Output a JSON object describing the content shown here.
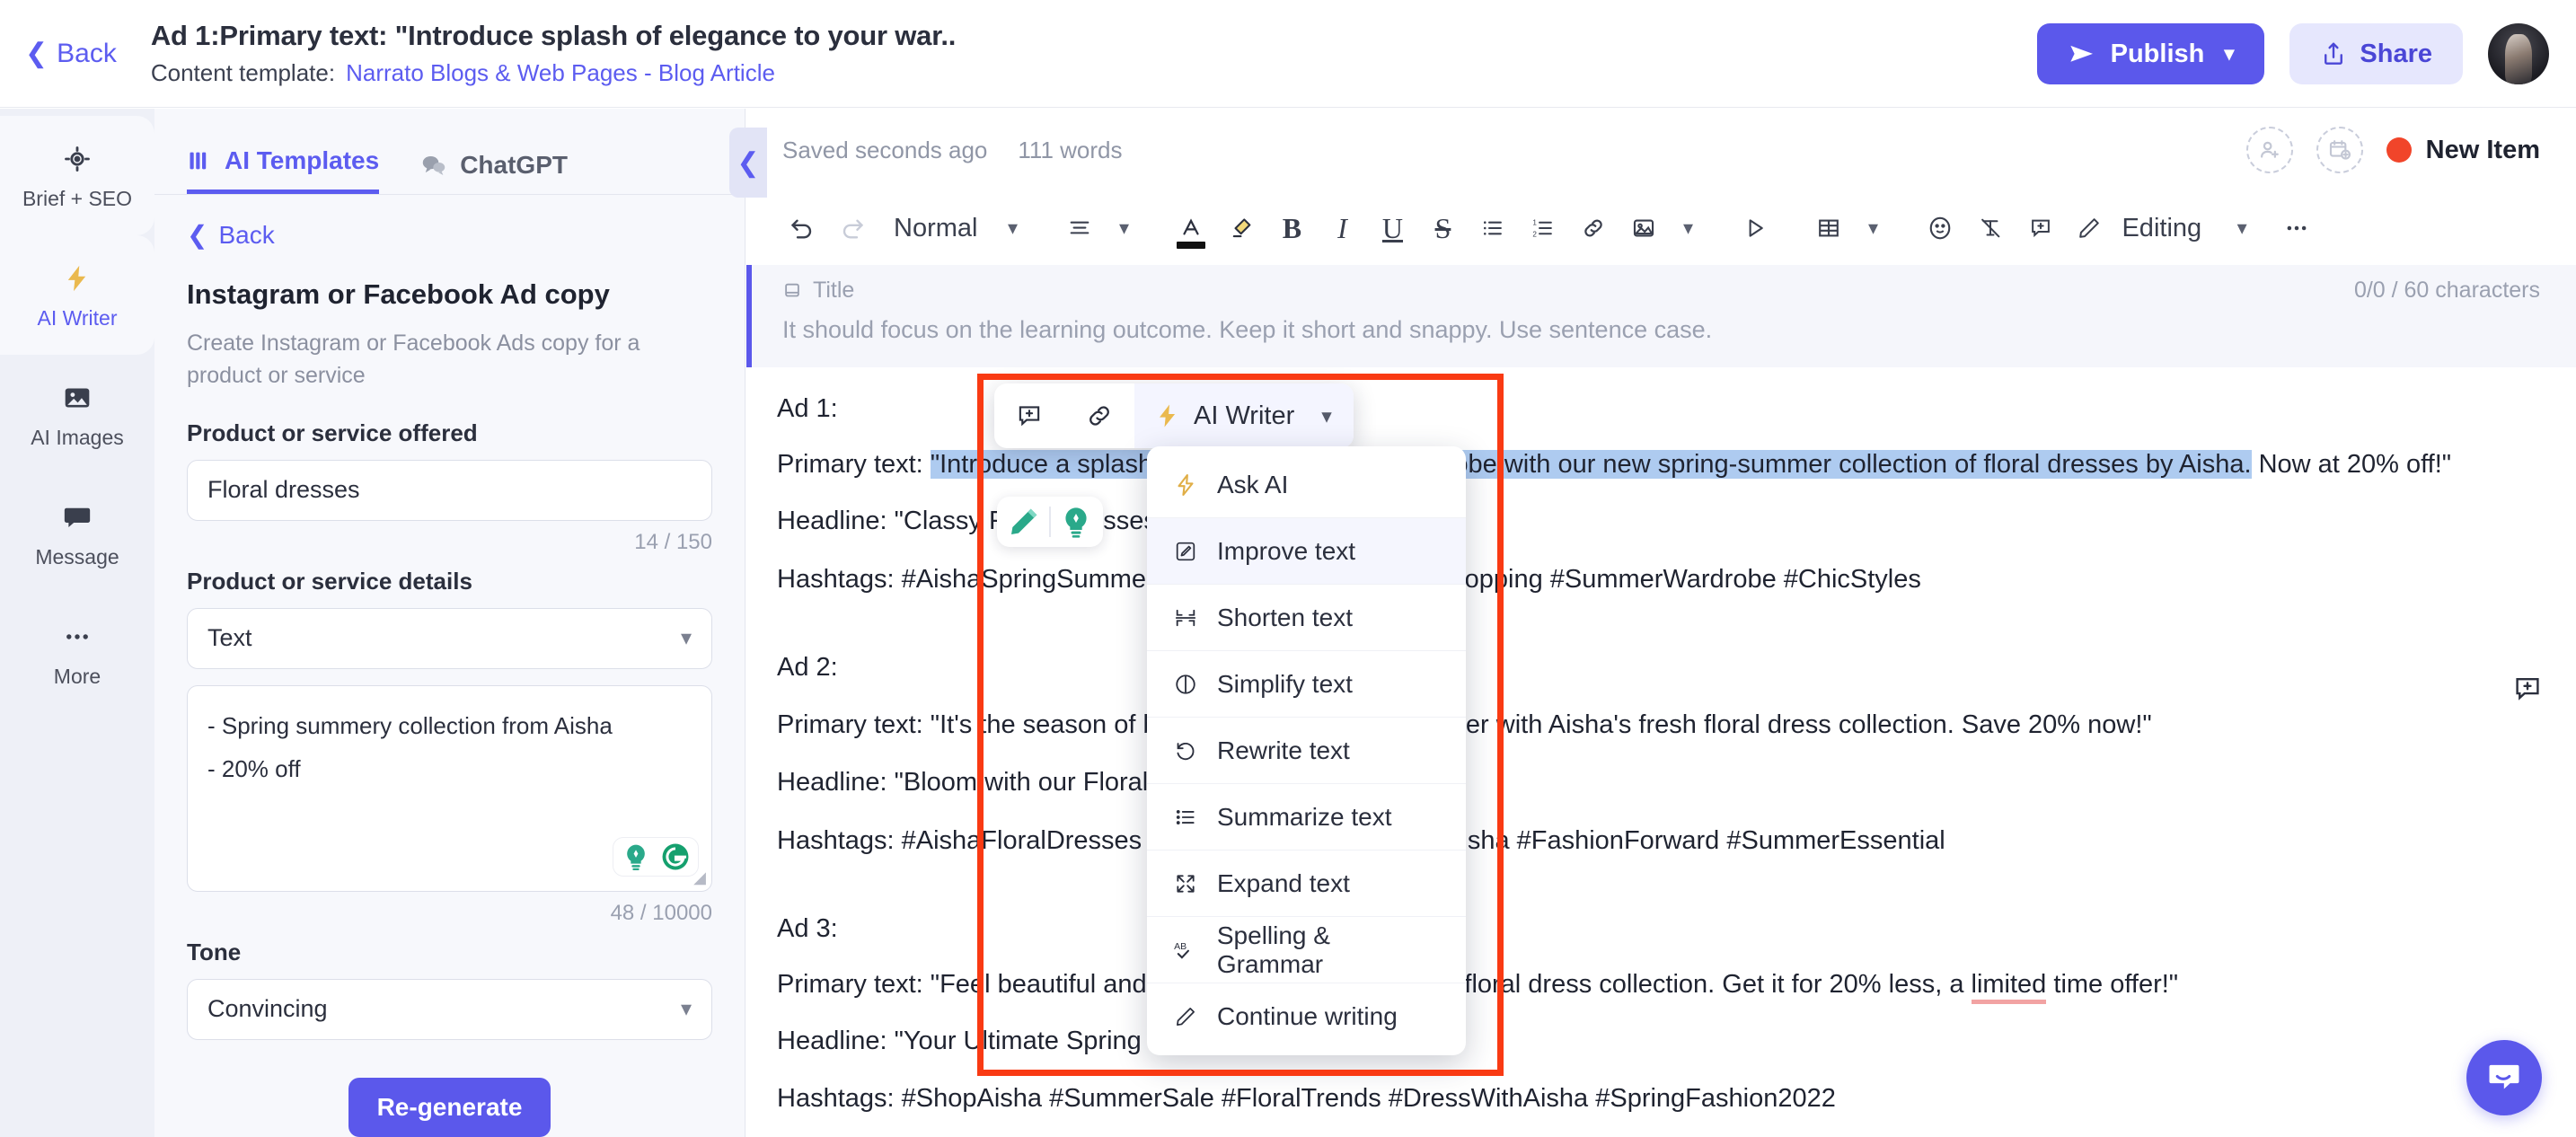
{
  "topbar": {
    "back_label": "Back",
    "doc_title": "Ad 1:Primary text: \"Introduce splash of elegance to your war..",
    "template_label": "Content template:",
    "template_link": "Narrato Blogs & Web Pages - Blog Article",
    "publish_label": "Publish",
    "share_label": "Share",
    "accent_color": "#5b58eb"
  },
  "rail": {
    "items": [
      {
        "label": "Brief + SEO",
        "icon": "target-icon",
        "state": "light"
      },
      {
        "label": "AI Writer",
        "icon": "lightning-icon",
        "state": "active"
      },
      {
        "label": "AI Images",
        "icon": "image-icon",
        "state": "normal"
      },
      {
        "label": "Message",
        "icon": "chat-icon",
        "state": "normal"
      },
      {
        "label": "More",
        "icon": "ellipsis-icon",
        "state": "normal"
      }
    ]
  },
  "panel": {
    "tabs": [
      {
        "label": "AI Templates",
        "icon": "templates-icon",
        "active": true
      },
      {
        "label": "ChatGPT",
        "icon": "chat-bubbles-icon",
        "active": false
      }
    ],
    "back_label": "Back",
    "heading": "Instagram or Facebook Ad copy",
    "subheading": "Create Instagram or Facebook Ads copy for a product or service",
    "fields": {
      "product_label": "Product or service offered",
      "product_value": "Floral dresses",
      "product_counter": "14 / 150",
      "details_label": "Product or service details",
      "details_type_value": "Text",
      "details_line1": "- Spring summery collection from Aisha",
      "details_line2": "- 20% off",
      "details_counter": "48 / 10000",
      "tone_label": "Tone",
      "tone_value": "Convincing"
    },
    "regenerate_label": "Re-generate",
    "collapse_icon": "chevron-left-icon"
  },
  "editor": {
    "status": {
      "saved": "Saved seconds ago",
      "words": "111 words",
      "invite_icon": "add-person-icon",
      "schedule_icon": "add-calendar-icon",
      "item_status": "New Item",
      "item_status_color": "#f1452a"
    },
    "toolbar": {
      "undo": "undo-icon",
      "redo": "redo-icon",
      "style_value": "Normal",
      "align": "align-icon",
      "font_color": "font-color-icon",
      "highlight": "highlighter-icon",
      "bold": "B",
      "italic": "I",
      "underline": "U",
      "strike": "S",
      "bullet_list": "bullet-list-icon",
      "numbered_list": "numbered-list-icon",
      "link": "link-icon",
      "image": "image-icon",
      "video": "play-icon",
      "table": "table-icon",
      "emoji": "emoji-icon",
      "clear_format": "clear-format-icon",
      "comment": "add-comment-icon",
      "mode_label": "Editing",
      "mode_icon": "pencil-icon",
      "more": "ellipsis-icon"
    },
    "title_block": {
      "label": "Title",
      "counter": "0/0 / 60 characters",
      "hint": "It should focus on the learning outcome. Keep it short and snappy. Use sentence case."
    },
    "content": {
      "ads": [
        {
          "heading": "Ad 1:",
          "primary_prefix": "Primary text: ",
          "primary_highlight": "\"Introduce a splash of elegance to your wardrobe with our new spring-summer collection of floral dresses by Aisha.",
          "primary_tail": " Now at 20% off!\"",
          "headline": "Headline: \"Classy Floral Dresses for Spring\"",
          "hashtags": "Hashtags: #AishaSpringSummer #FloralDress #DiscountShopping #SummerWardrobe #ChicStyles"
        },
        {
          "heading": "Ad 2:",
          "primary": "Primary text: \"It's the season of blooming fashion this summer with Aisha's fresh floral dress collection. Save 20% now!\"",
          "headline": "Headline: \"Bloom with our Floral Dresses\"",
          "hashtags": "Hashtags: #AishaFloralDresses #SpringStyle #BloomWithAisha #FashionForward #SummerEssential"
        },
        {
          "heading": "Ad 3:",
          "primary_a": "Primary text: \"Feel beautiful and confident with Aisha's new floral dress collection. Get it for 20% less, a ",
          "primary_err": "limited",
          "primary_b": " time offer!\"",
          "headline": "Headline: \"Your Ultimate Spring Wardrobe\"",
          "hashtags": "Hashtags: #ShopAisha #SummerSale #FloralTrends #DressWithAisha #SpringFashion2022"
        }
      ]
    },
    "ai_toolbar": {
      "comment_icon": "add-comment-icon",
      "link_icon": "link-icon",
      "ai_writer_label": "AI Writer",
      "ai_writer_icon": "lightning-icon",
      "chevron": "chevron-down-icon"
    },
    "ai_menu": {
      "items": [
        {
          "label": "Ask AI",
          "icon": "lightning-icon",
          "hover": false
        },
        {
          "label": "Improve text",
          "icon": "improve-icon",
          "hover": true
        },
        {
          "label": "Shorten text",
          "icon": "shorten-icon",
          "hover": false
        },
        {
          "label": "Simplify text",
          "icon": "simplify-icon",
          "hover": false
        },
        {
          "label": "Rewrite text",
          "icon": "rewrite-icon",
          "hover": false
        },
        {
          "label": "Summarize text",
          "icon": "summarize-icon",
          "hover": false
        },
        {
          "label": "Expand text",
          "icon": "expand-icon",
          "hover": false
        },
        {
          "label": "Spelling & Grammar",
          "icon": "spellcheck-icon",
          "hover": false
        },
        {
          "label": "Continue writing",
          "icon": "pencil-icon",
          "hover": false
        }
      ]
    },
    "chat_fab_icon": "chat-bubble-icon",
    "annotation_box_color": "#f93a13"
  }
}
